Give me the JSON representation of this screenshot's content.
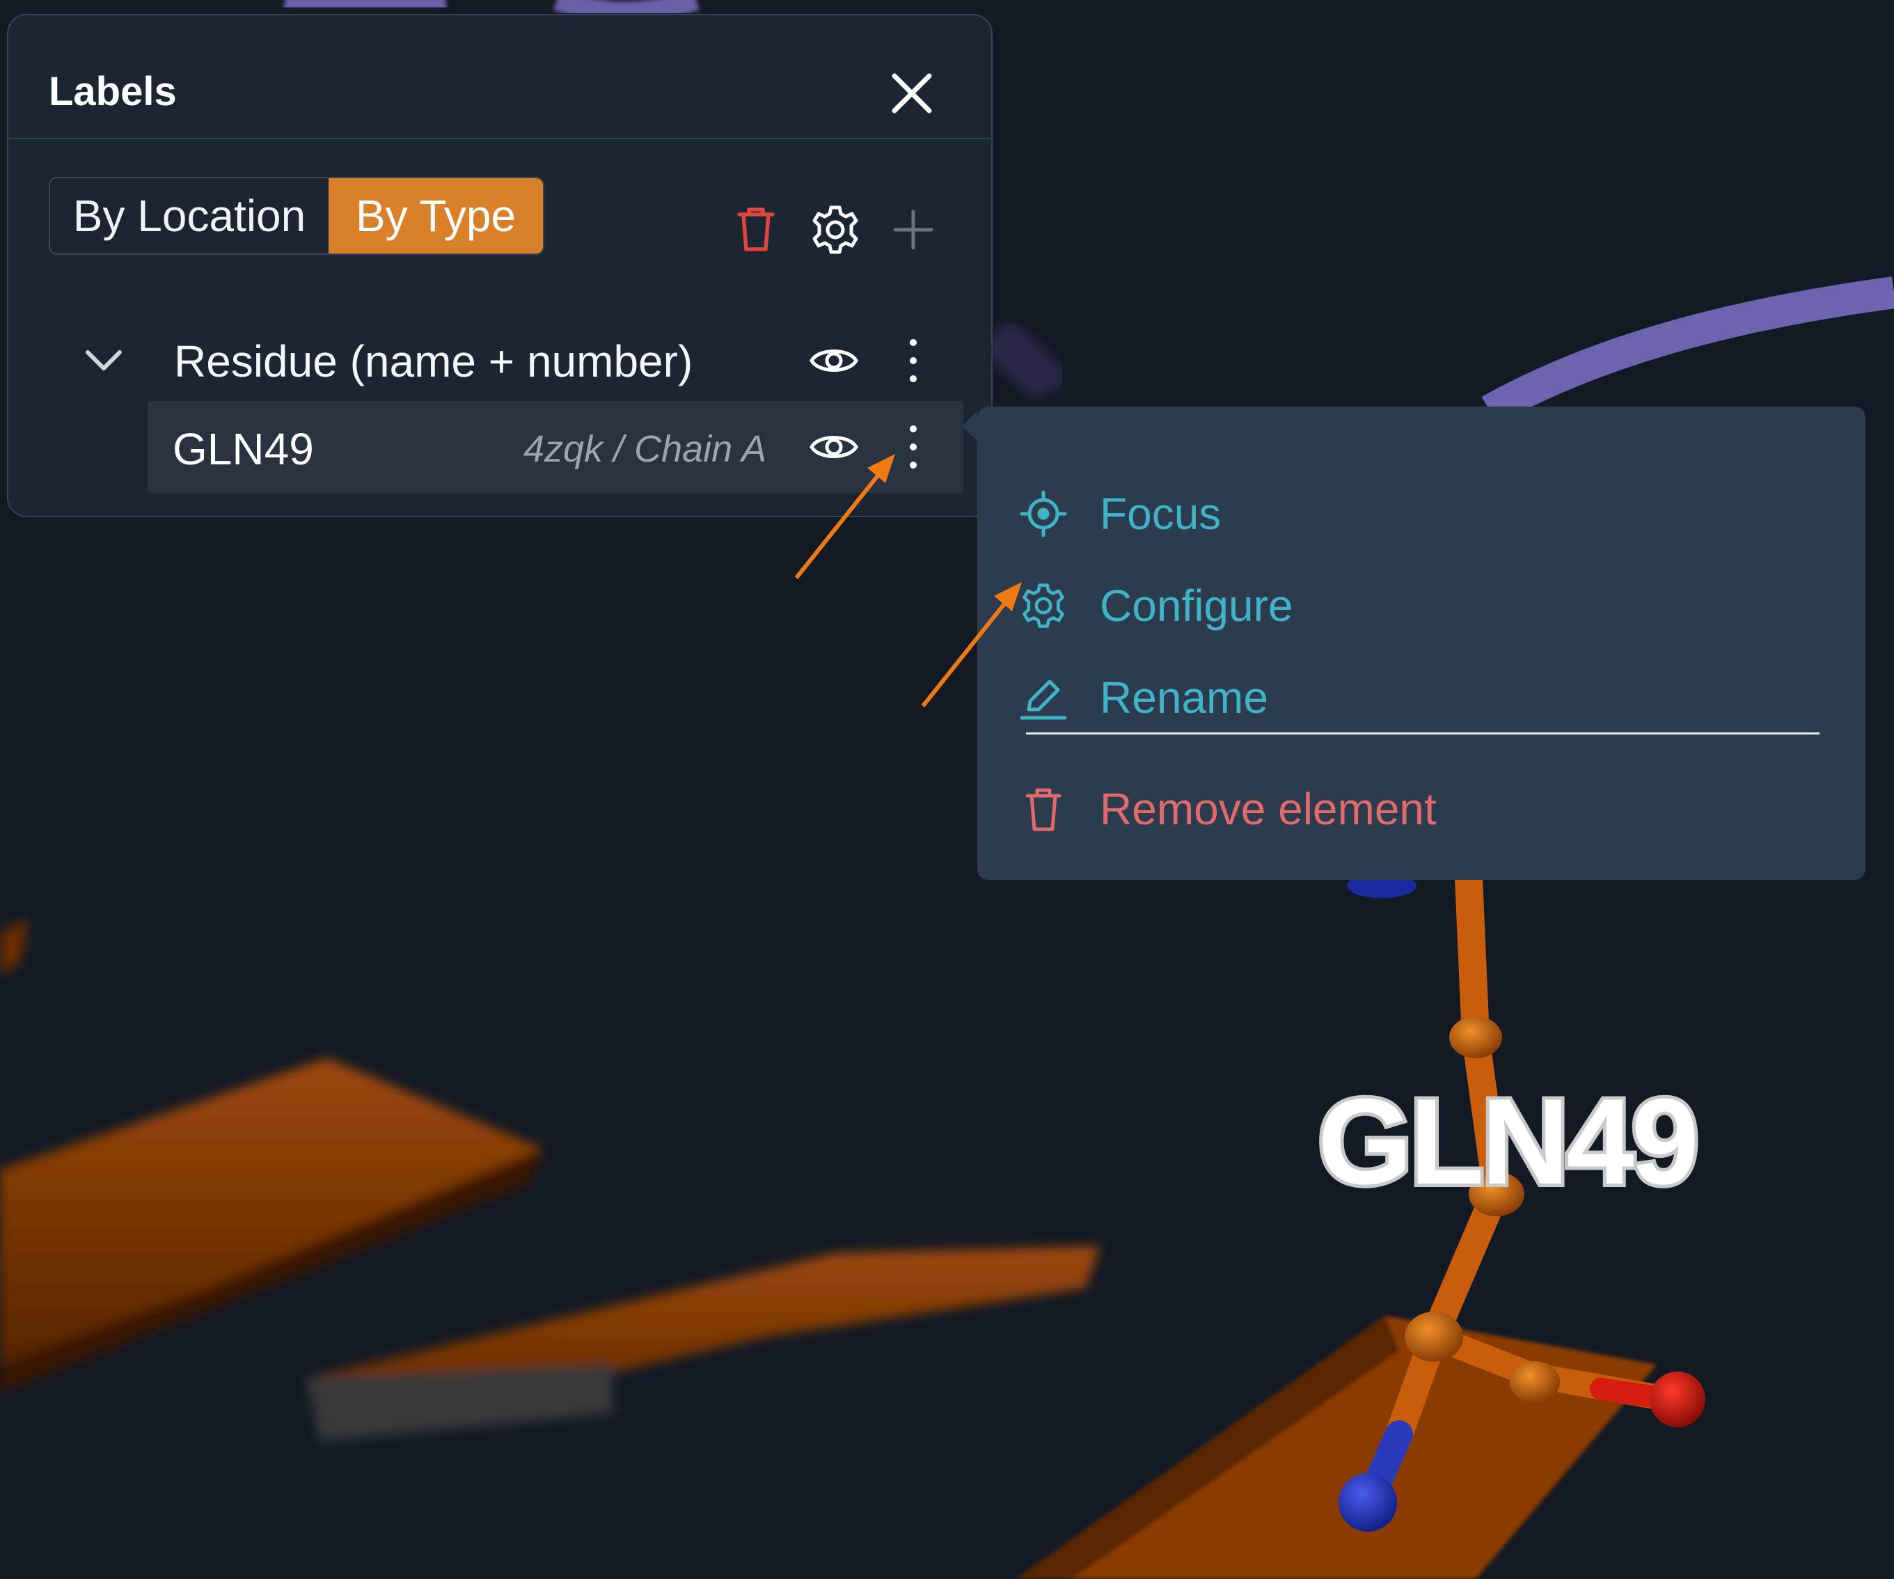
{
  "panel": {
    "title": "Labels",
    "close_icon": "close-icon"
  },
  "toolbar": {
    "tab_location": "By Location",
    "tab_type": "By Type",
    "active_tab": "By Type",
    "delete_icon": "trash-icon",
    "settings_icon": "gear-icon",
    "add_icon": "plus-icon"
  },
  "tree": {
    "group": {
      "label": "Residue (name + number)",
      "expanded": true
    },
    "items": [
      {
        "label": "GLN49",
        "meta": "4zqk / Chain A"
      }
    ]
  },
  "context_menu": {
    "items": [
      {
        "label": "Focus",
        "icon": "crosshair-icon"
      },
      {
        "label": "Configure",
        "icon": "gear-icon"
      },
      {
        "label": "Rename",
        "icon": "pencil-icon"
      }
    ],
    "remove": {
      "label": "Remove element",
      "icon": "trash-icon"
    }
  },
  "viewport": {
    "residue_label": "GLN49"
  },
  "colors": {
    "accent": "#d9802b",
    "menu_text": "#3fb3c8",
    "danger": "#e06b6b",
    "panel_bg": "#1c2633",
    "menu_bg": "#2c3b4d"
  }
}
